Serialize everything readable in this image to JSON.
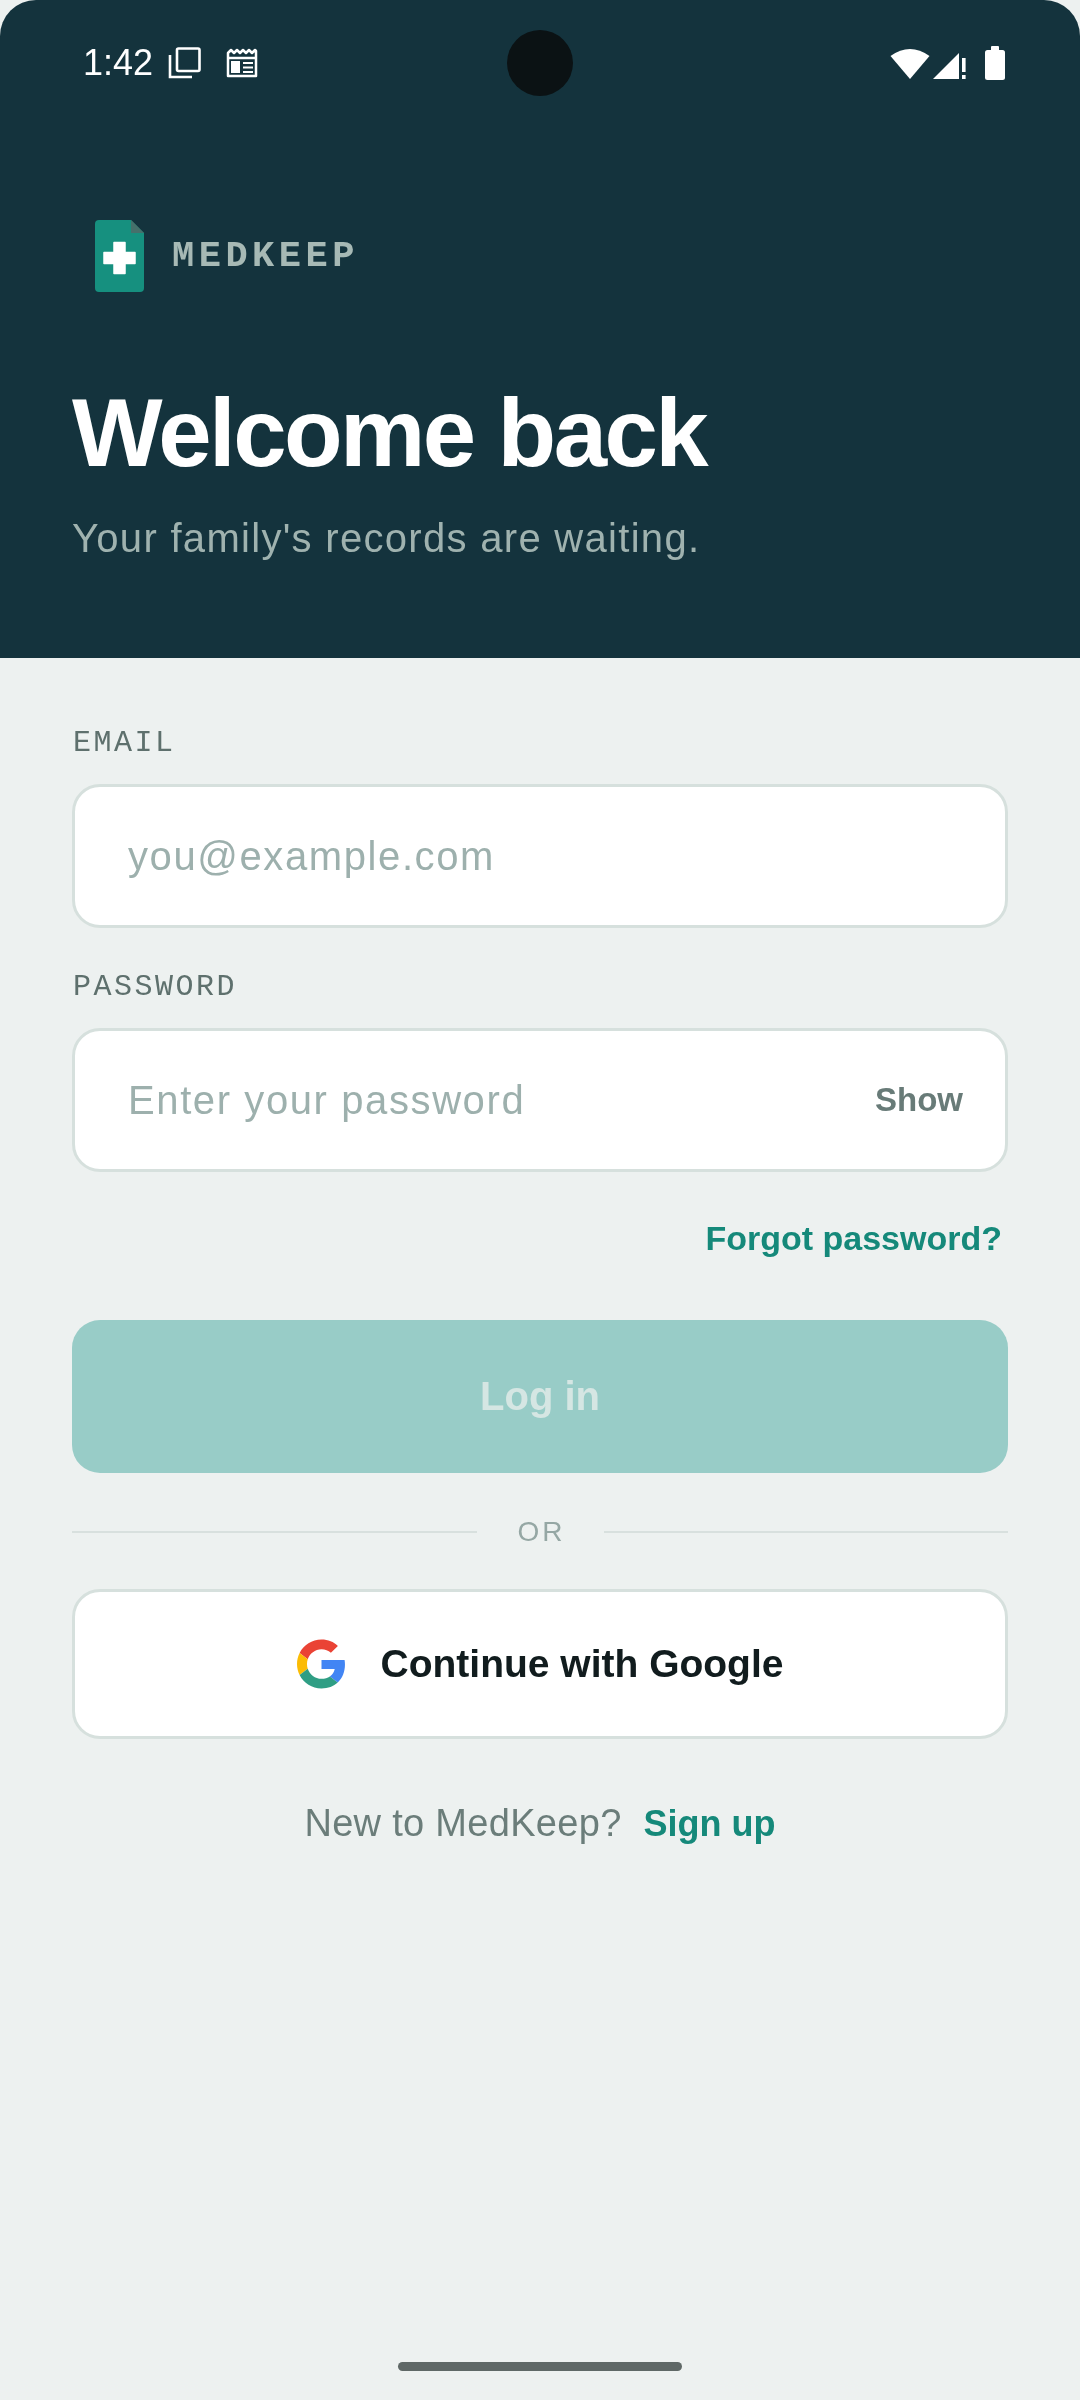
{
  "status_bar": {
    "time": "1:42"
  },
  "brand": {
    "name": "MEDKEEP"
  },
  "header": {
    "title": "Welcome back",
    "subtitle": "Your family's records are waiting."
  },
  "form": {
    "email": {
      "label": "EMAIL",
      "placeholder": "you@example.com"
    },
    "password": {
      "label": "PASSWORD",
      "placeholder": "Enter your password",
      "toggle": "Show"
    },
    "forgot_link": "Forgot password?",
    "login_button": {
      "label": "Log in",
      "disabled": true
    },
    "divider": "OR",
    "google_button": {
      "label": "Continue with Google"
    },
    "signup": {
      "prompt": "New to MedKeep?",
      "link": "Sign up"
    }
  }
}
